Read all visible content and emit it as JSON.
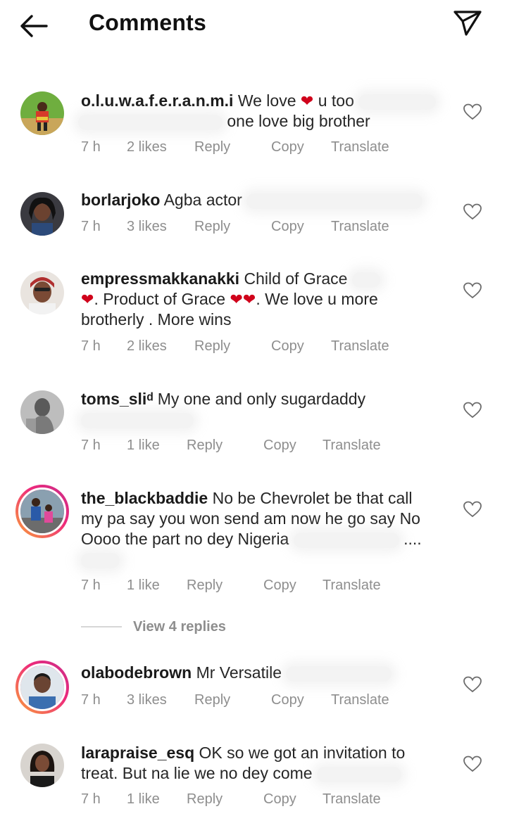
{
  "header": {
    "title": "Comments",
    "back_icon": "arrow-left-icon",
    "send_icon": "paper-plane-icon"
  },
  "comments": [
    {
      "username": "o.l.u.w.a.f.e.r.a.n.m.i",
      "text_a": "We love",
      "text_b": "u too",
      "text_c": "one love big brother",
      "time": "7 h",
      "likes": "2 likes",
      "reply": "Reply",
      "copy": "Copy",
      "translate": "Translate"
    },
    {
      "username": "borlarjoko",
      "text_a": "Agba actor",
      "time": "7 h",
      "likes": "3 likes",
      "reply": "Reply",
      "copy": "Copy",
      "translate": "Translate"
    },
    {
      "username": "empressmakkanakki",
      "text_a": "Child of Grace",
      "text_b": ". Product of Grace",
      "text_c": ". We love u more",
      "text_d": "brotherly . More wins",
      "time": "7 h",
      "likes": "2 likes",
      "reply": "Reply",
      "copy": "Copy",
      "translate": "Translate"
    },
    {
      "username": "toms_sliᵈ",
      "text_a": "My one and only sugardaddy",
      "time": "7 h",
      "likes": "1 like",
      "reply": "Reply",
      "copy": "Copy",
      "translate": "Translate"
    },
    {
      "username": "the_blackbaddie",
      "text_a": "No be Chevrolet be that call",
      "text_b": "my pa say you won send am now he go say No",
      "text_c": "Oooo the part no dey Nigeria",
      "text_d": "....",
      "time": "7 h",
      "likes": "1 like",
      "reply": "Reply",
      "copy": "Copy",
      "translate": "Translate"
    },
    {
      "username": "olabodebrown",
      "text_a": "Mr Versatile",
      "time": "7 h",
      "likes": "3 likes",
      "reply": "Reply",
      "copy": "Copy",
      "translate": "Translate"
    },
    {
      "username": "larapraise_esq",
      "text_a": "OK so we got an invitation to",
      "text_b": "treat. But na lie we no dey come",
      "time": "7 h",
      "likes": "1 like",
      "reply": "Reply",
      "copy": "Copy",
      "translate": "Translate"
    }
  ],
  "view_replies": "View 4 replies",
  "colors": {
    "heart": "#d0021b",
    "meta": "#8e8e8e",
    "story_ring_start": "#f9a13a",
    "story_ring_end": "#c72d8a"
  }
}
